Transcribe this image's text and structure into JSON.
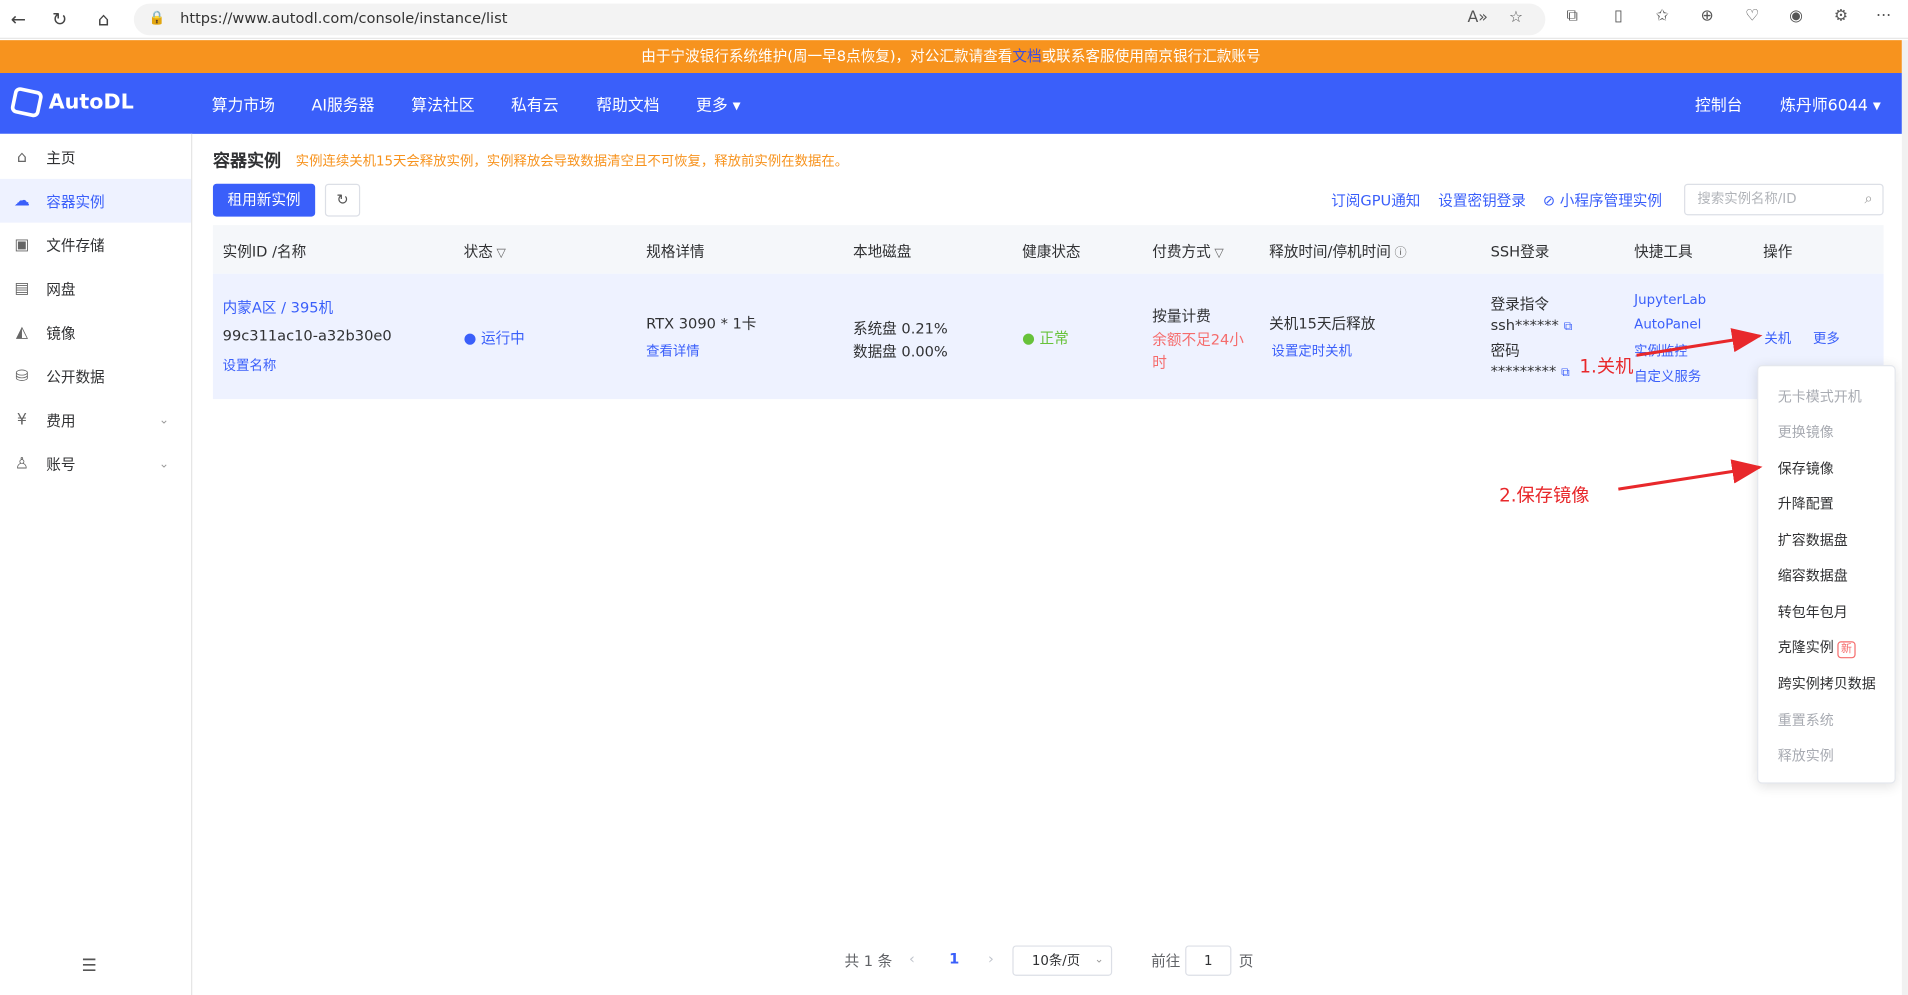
{
  "browser": {
    "url": "https://www.autodl.com/console/instance/list"
  },
  "notice": {
    "text_before": "由于宁波银行系统维护(周一早8点恢复)，对公汇款请查看",
    "link": "文档",
    "text_after": "或联系客服使用南京银行汇款账号"
  },
  "header": {
    "logo": "AutoDL",
    "nav": [
      "算力市场",
      "AI服务器",
      "算法社区",
      "私有云",
      "帮助文档",
      "更多 ▾"
    ],
    "console": "控制台",
    "user": "炼丹师6044 ▾"
  },
  "sidebar": {
    "items": [
      {
        "label": "主页",
        "icon": "home-icon"
      },
      {
        "label": "容器实例",
        "icon": "container-icon"
      },
      {
        "label": "文件存储",
        "icon": "storage-icon"
      },
      {
        "label": "网盘",
        "icon": "disk-icon"
      },
      {
        "label": "镜像",
        "icon": "image-icon"
      },
      {
        "label": "公开数据",
        "icon": "database-icon"
      },
      {
        "label": "费用",
        "icon": "yen-icon"
      },
      {
        "label": "账号",
        "icon": "user-icon"
      }
    ]
  },
  "page": {
    "title": "容器实例",
    "tip": "实例连续关机15天会释放实例，实例释放会导致数据清空且不可恢复，释放前实例在数据在。",
    "new_button": "租用新实例",
    "links": [
      "订阅GPU通知",
      "设置密钥登录",
      "小程序管理实例"
    ],
    "search_placeholder": "搜索实例名称/ID"
  },
  "table": {
    "headers": [
      "实例ID /名称",
      "状态",
      "规格详情",
      "本地磁盘",
      "健康状态",
      "付费方式",
      "释放时间/停机时间",
      "SSH登录",
      "快捷工具",
      "操作"
    ],
    "row": {
      "region": "内蒙A区 / 395机",
      "id": "99c311ac10-a32b30e0",
      "set_name": "设置名称",
      "status": "● 运行中",
      "spec": "RTX 3090 * 1卡",
      "spec_detail": "查看详情",
      "sys_disk": "系统盘 0.21%",
      "data_disk": "数据盘 0.00%",
      "health": "● 正常",
      "billing": "按量计费",
      "billing_warn_1": "余额不足24小",
      "billing_warn_2": "时",
      "release": "关机15天后释放",
      "release_link": "设置定时关机",
      "ssh_cmd_label": "登录指令",
      "ssh_cmd": "ssh******",
      "pwd_label": "密码",
      "pwd": "*********",
      "tools": [
        "JupyterLab",
        "AutoPanel",
        "实例监控",
        "自定义服务"
      ],
      "shutdown": "关机",
      "more": "更多"
    }
  },
  "dropdown": [
    {
      "label": "无卡模式开机",
      "disabled": true
    },
    {
      "label": "更换镜像",
      "disabled": true
    },
    {
      "label": "保存镜像",
      "disabled": false
    },
    {
      "label": "升降配置",
      "disabled": false
    },
    {
      "label": "扩容数据盘",
      "disabled": false
    },
    {
      "label": "缩容数据盘",
      "disabled": false
    },
    {
      "label": "转包年包月",
      "disabled": false
    },
    {
      "label": "克隆实例",
      "disabled": false
    },
    {
      "label": "跨实例拷贝数据",
      "disabled": false
    },
    {
      "label": "重置系统",
      "disabled": true
    },
    {
      "label": "释放实例",
      "disabled": true
    }
  ],
  "dropdown_badge": "新",
  "annotations": {
    "step1": "1.关机",
    "step2": "2.保存镜像",
    "color": "#e8282b"
  },
  "pagination": {
    "total": "共 1 条",
    "current": "1",
    "page_size": "10条/页",
    "goto_label": "前往",
    "goto_value": "1",
    "page_suffix": "页"
  },
  "colors": {
    "primary": "#3a5ffa",
    "notice": "#f7931e"
  }
}
